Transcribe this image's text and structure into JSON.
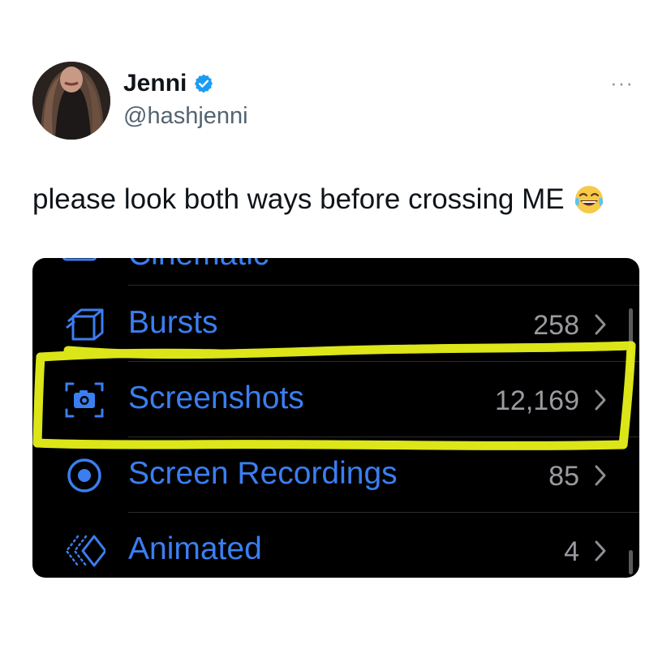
{
  "tweet": {
    "author_name": "Jenni",
    "author_handle": "@hashjenni",
    "more_label": "···",
    "text": "please look both ways before crossing ME"
  },
  "screenshot": {
    "cut_off_label": "Cinematic",
    "rows": [
      {
        "label": "Bursts",
        "count": "258",
        "icon": "bursts-icon"
      },
      {
        "label": "Screenshots",
        "count": "12,169",
        "icon": "screenshot-icon"
      },
      {
        "label": "Screen Recordings",
        "count": "85",
        "icon": "screen-recording-icon"
      },
      {
        "label": "Animated",
        "count": "4",
        "icon": "animated-icon"
      }
    ]
  },
  "colors": {
    "accent": "#3b7ef0",
    "verified": "#1d9bf0",
    "highlighter": "#e8f21a"
  }
}
